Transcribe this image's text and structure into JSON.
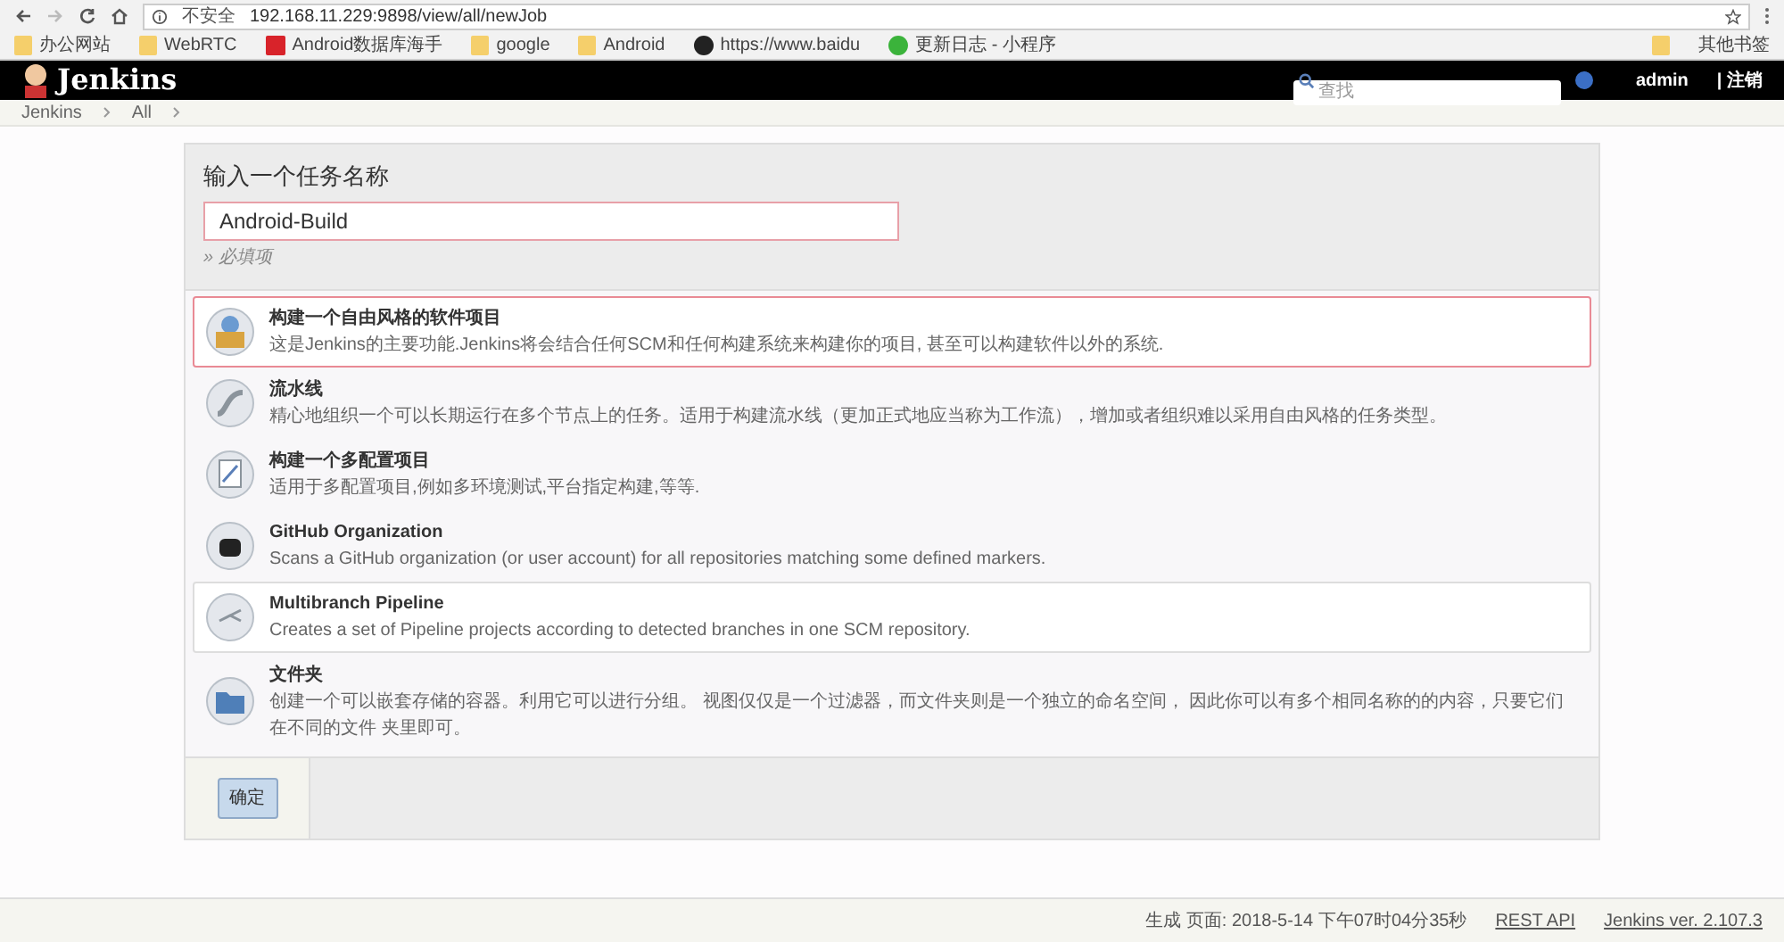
{
  "browser": {
    "security": "不安全",
    "url": "192.168.11.229:9898/view/all/newJob",
    "bookmarks": [
      {
        "label": "办公网站",
        "kind": "folder"
      },
      {
        "label": "WebRTC",
        "kind": "folder"
      },
      {
        "label": "Android数据库海手",
        "kind": "app"
      },
      {
        "label": "google",
        "kind": "folder"
      },
      {
        "label": "Android",
        "kind": "folder"
      },
      {
        "label": "https://www.baidu",
        "kind": "github"
      },
      {
        "label": "更新日志 - 小程序",
        "kind": "chat"
      }
    ],
    "other_bookmarks": "其他书签"
  },
  "header": {
    "logo": "Jenkins",
    "search_placeholder": "查找",
    "user": "admin",
    "logout": "| 注销"
  },
  "breadcrumbs": [
    "Jenkins",
    "All"
  ],
  "form": {
    "title": "输入一个任务名称",
    "name_value": "Android-Build",
    "required_note": "» 必填项",
    "items": [
      {
        "title": "构建一个自由风格的软件项目",
        "description": "这是Jenkins的主要功能.Jenkins将会结合任何SCM和任何构建系统来构建你的项目, 甚至可以构建软件以外的系统.",
        "kind": "freestyle",
        "selected": true,
        "highlighted": true
      },
      {
        "title": "流水线",
        "description": "精心地组织一个可以长期运行在多个节点上的任务。适用于构建流水线（更加正式地应当称为工作流），增加或者组织难以采用自由风格的任务类型。",
        "kind": "pipeline",
        "selected": false,
        "highlighted": false
      },
      {
        "title": "构建一个多配置项目",
        "description": "适用于多配置项目,例如多环境测试,平台指定构建,等等.",
        "kind": "matrix",
        "selected": false,
        "highlighted": false
      },
      {
        "title": "GitHub Organization",
        "description": "Scans a GitHub organization (or user account) for all repositories matching some defined markers.",
        "kind": "github",
        "selected": false,
        "highlighted": false
      },
      {
        "title": "Multibranch Pipeline",
        "description": "Creates a set of Pipeline projects according to detected branches in one SCM repository.",
        "kind": "multibranch",
        "selected": false,
        "highlighted": true
      },
      {
        "title": "文件夹",
        "description": "创建一个可以嵌套存储的容器。利用它可以进行分组。 视图仅仅是一个过滤器，而文件夹则是一个独立的命名空间， 因此你可以有多个相同名称的的内容，只要它们在不同的文件 夹里即可。",
        "kind": "folder",
        "selected": false,
        "highlighted": false
      }
    ],
    "ok_button": "确定"
  },
  "footer": {
    "generated": "生成 页面: 2018-5-14 下午07时04分35秒",
    "rest_api": "REST API",
    "version": "Jenkins ver. 2.107.3"
  }
}
